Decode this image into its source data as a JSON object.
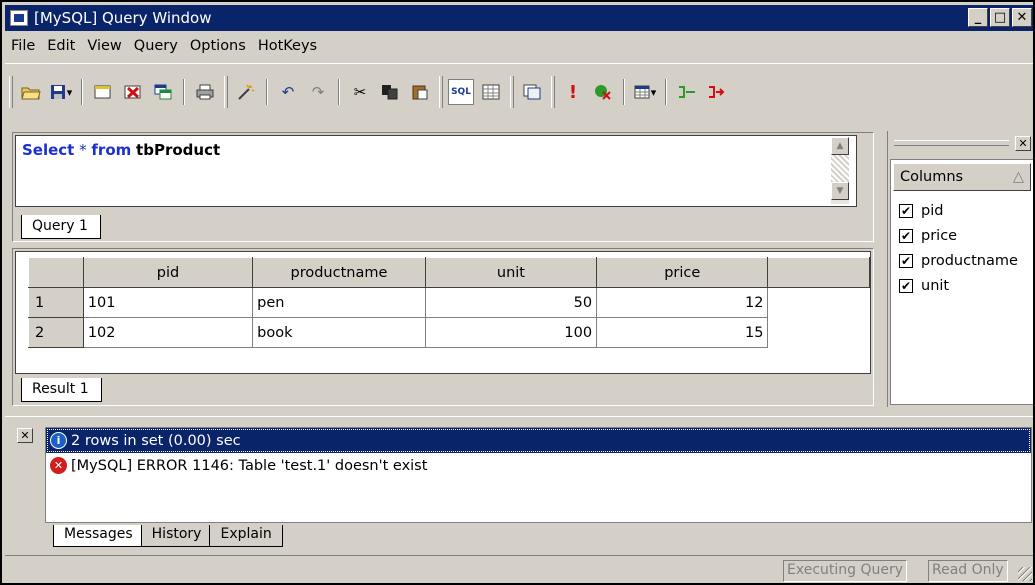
{
  "window": {
    "title": "[MySQL] Query Window",
    "minimize": "_",
    "maximize": "□",
    "close": "✕"
  },
  "menu": [
    "File",
    "Edit",
    "View",
    "Query",
    "Options",
    "HotKeys"
  ],
  "toolbar": {
    "icons": [
      "open-folder-icon",
      "save-icon",
      "new-query-icon",
      "delete-query-icon",
      "window-icon",
      "print-icon",
      "magic-wand-icon",
      "undo-icon",
      "redo-icon",
      "cut-icon",
      "copy-icon",
      "paste-icon",
      "sql-icon",
      "grid-icon",
      "results-icon",
      "execute-icon",
      "stop-icon",
      "table-view-icon",
      "insert-icon",
      "remove-icon"
    ],
    "sql_label": "SQL"
  },
  "query": {
    "kw1": "Select",
    "star": " * ",
    "kw2": "from",
    "table": "tbProduct",
    "tab": "Query 1"
  },
  "result": {
    "columns": [
      "pid",
      "productname",
      "unit",
      "price"
    ],
    "rows": [
      {
        "n": "1",
        "pid": "101",
        "productname": "pen",
        "unit": "50",
        "price": "12"
      },
      {
        "n": "2",
        "pid": "102",
        "productname": "book",
        "unit": "100",
        "price": "15"
      }
    ],
    "tab": "Result 1"
  },
  "sidebar": {
    "header": "Columns",
    "sort_glyph": "△",
    "close": "✕",
    "items": [
      "pid",
      "price",
      "productname",
      "unit"
    ]
  },
  "messages": {
    "close": "✕",
    "items": [
      "2 rows in set (0.00) sec",
      "[MySQL] ERROR 1146: Table 'test.1' doesn't exist"
    ],
    "tabs": [
      "Messages",
      "History",
      "Explain"
    ]
  },
  "status": {
    "executing": "Executing Query",
    "readonly": "Read Only"
  }
}
